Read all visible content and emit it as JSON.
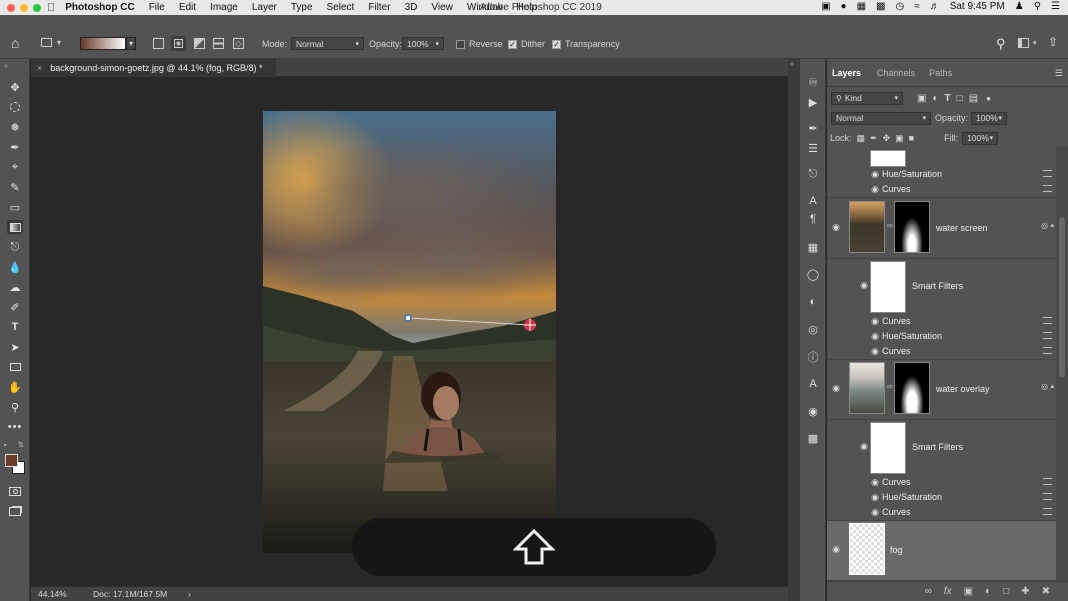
{
  "menubar": {
    "apple_icon": "apple-icon",
    "app_name": "Photoshop CC",
    "items": [
      "File",
      "Edit",
      "Image",
      "Layer",
      "Type",
      "Select",
      "Filter",
      "3D",
      "View",
      "Window",
      "Help"
    ],
    "window_title": "Adobe Photoshop CC 2019",
    "clock": "Sat 9:45 PM"
  },
  "options": {
    "mode_label": "Mode:",
    "mode_value": "Normal",
    "opacity_label": "Opacity:",
    "opacity_value": "100%",
    "reverse_label": "Reverse",
    "reverse_checked": false,
    "dither_label": "Dither",
    "dither_checked": true,
    "transparency_label": "Transparency",
    "transparency_checked": true
  },
  "document": {
    "tab_title": "background-simon-goetz.jpg @ 44.1% (fog, RGB/8) *",
    "close_glyph": "×"
  },
  "status": {
    "zoom": "44.14%",
    "doc_info": "Doc: 17.1M/167.5M",
    "arrow": "›"
  },
  "panel": {
    "tabs": [
      "Layers",
      "Channels",
      "Paths"
    ],
    "active_tab": "Layers",
    "filter_label": "Kind",
    "blend_mode": "Normal",
    "opacity_label": "Opacity:",
    "opacity_value": "100%",
    "lock_label": "Lock:",
    "fill_label": "Fill:",
    "fill_value": "100%"
  },
  "layers": {
    "top_fx": [
      "Hue/Saturation",
      "Curves"
    ],
    "water_screen": {
      "name": "water screen",
      "smart_filters": "Smart Filters",
      "fx": [
        "Curves",
        "Hue/Saturation",
        "Curves"
      ]
    },
    "water_overlay": {
      "name": "water overlay",
      "smart_filters": "Smart Filters",
      "fx": [
        "Curves",
        "Hue/Saturation",
        "Curves"
      ]
    },
    "fog": {
      "name": "fog"
    }
  },
  "colors": {
    "foreground": "#6b3a2a",
    "background": "#ffffff",
    "accent_marker": "#d0334a"
  }
}
